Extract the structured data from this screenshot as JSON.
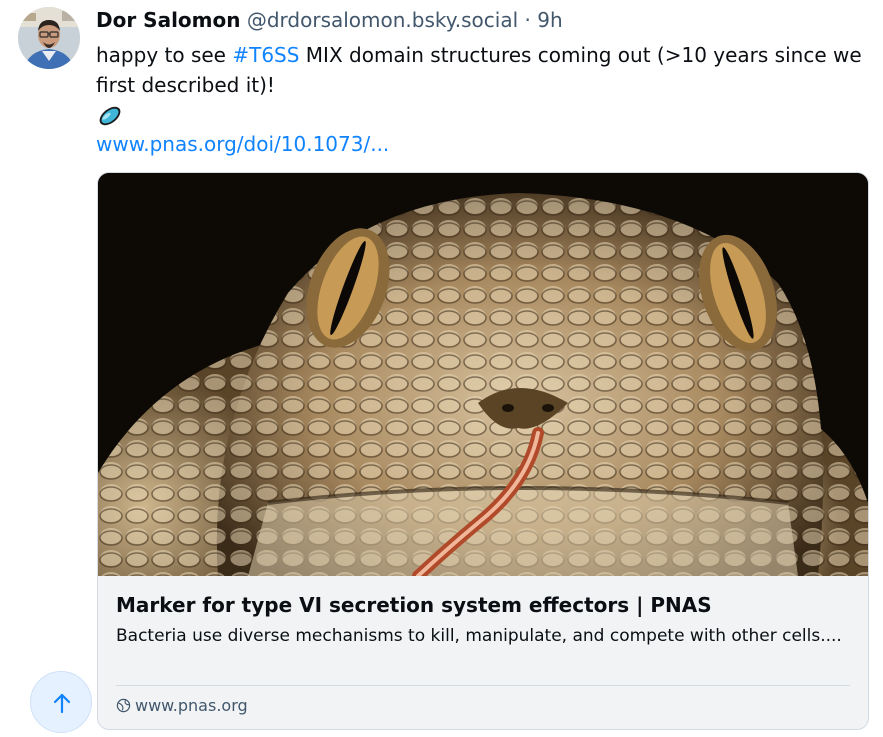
{
  "post": {
    "author": {
      "name": "Dor Salomon",
      "handle": "@drdorsalomon.bsky.social",
      "separator": "·",
      "time": "9h",
      "avatar_icon": "user-avatar-photo"
    },
    "text": {
      "before_tag": "happy to see ",
      "hashtag": "#T6SS",
      "after_tag": " MIX domain structures coming out (>10 years since we first described it)!"
    },
    "emoji_icon": "blue-pill-emoji",
    "link_text": "www.pnas.org/doi/10.1073/...",
    "embed": {
      "image_icon": "rattlesnake-head-photo",
      "title": "Marker for type VI secretion system effectors | PNAS",
      "description": "Bacteria use diverse mechanisms to kill, manipulate, and compete with other cells....",
      "domain_icon": "globe-icon",
      "domain": "www.pnas.org"
    }
  },
  "scroll_to_top_icon": "arrow-up-icon",
  "colors": {
    "link": "#1083fe",
    "muted": "#42576c",
    "text": "#0b0f14",
    "card_border": "#d4dbe2",
    "card_bg": "#f1f3f5",
    "fab_bg": "#e6f1ff"
  }
}
